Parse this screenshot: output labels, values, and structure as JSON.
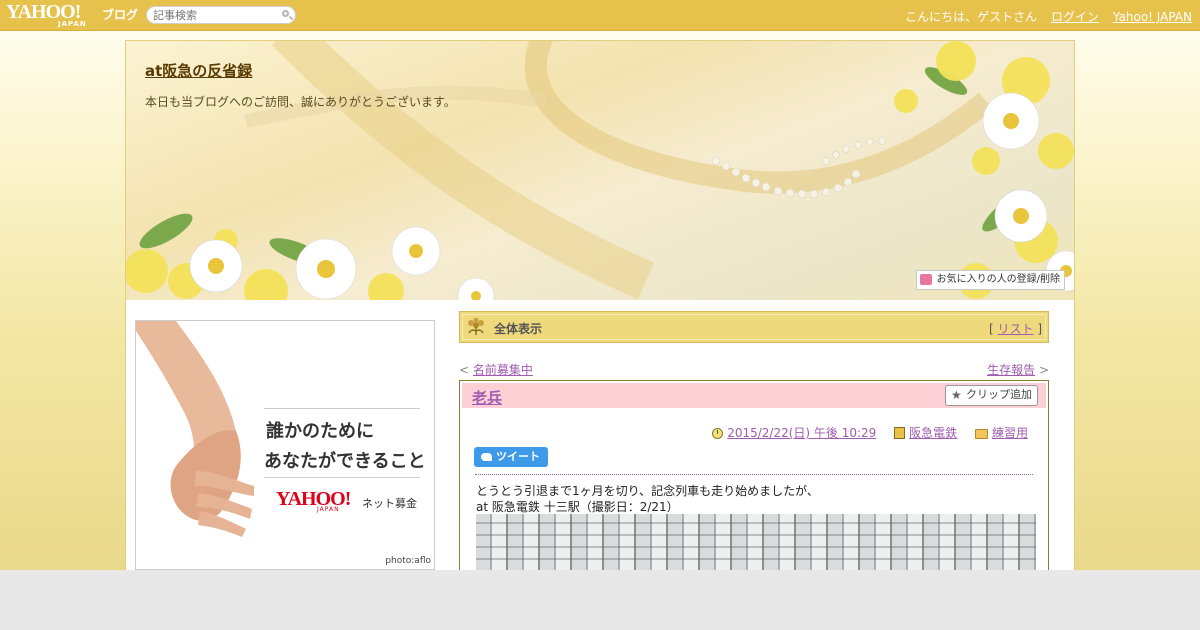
{
  "topbar": {
    "logo_text": "YAHOO!",
    "logo_sub": "JAPAN",
    "logo_service": "ブログ",
    "search_placeholder": "記事検索",
    "greeting": "こんにちは、ゲストさん",
    "login": "ログイン",
    "yahoo_japan": "Yahoo! JAPAN"
  },
  "blog": {
    "title": "at阪急の反省録",
    "description": "本日も当ブログへのご訪問、誠にありがとうございます。",
    "favorite_button": "お気に入りの人の登録/削除"
  },
  "ad": {
    "line1": "誰かのために",
    "line2": "あなたができること",
    "brand": "YAHOO!",
    "brand_sub": "JAPAN",
    "service": "ネット募金",
    "credit": "photo:aflo"
  },
  "section": {
    "label": "全体表示",
    "list_open": "[",
    "list_link": "リスト",
    "list_close": "]"
  },
  "nav": {
    "prev_arrow": "<",
    "prev_label": "名前募集中",
    "next_label": "生存報告",
    "next_arrow": ">"
  },
  "article": {
    "title": "老兵",
    "clip_button": "クリップ追加",
    "datetime": "2015/2/22(日) 午後 10:29",
    "category1": "阪急電鉄",
    "category2": "練習用",
    "tweet_button": "ツイート",
    "body_line1": "とうとう引退まで1ヶ月を切り、記念列車も走り始めましたが、",
    "body_line2": "at 阪急電鉄 十三駅（撮影日：2/21）"
  },
  "colors": {
    "topbar": "#e6c14c",
    "link": "#a05cb0",
    "article_header": "#fdd0d6",
    "section_bar": "#efd97d",
    "tweet": "#3d9ae8"
  }
}
